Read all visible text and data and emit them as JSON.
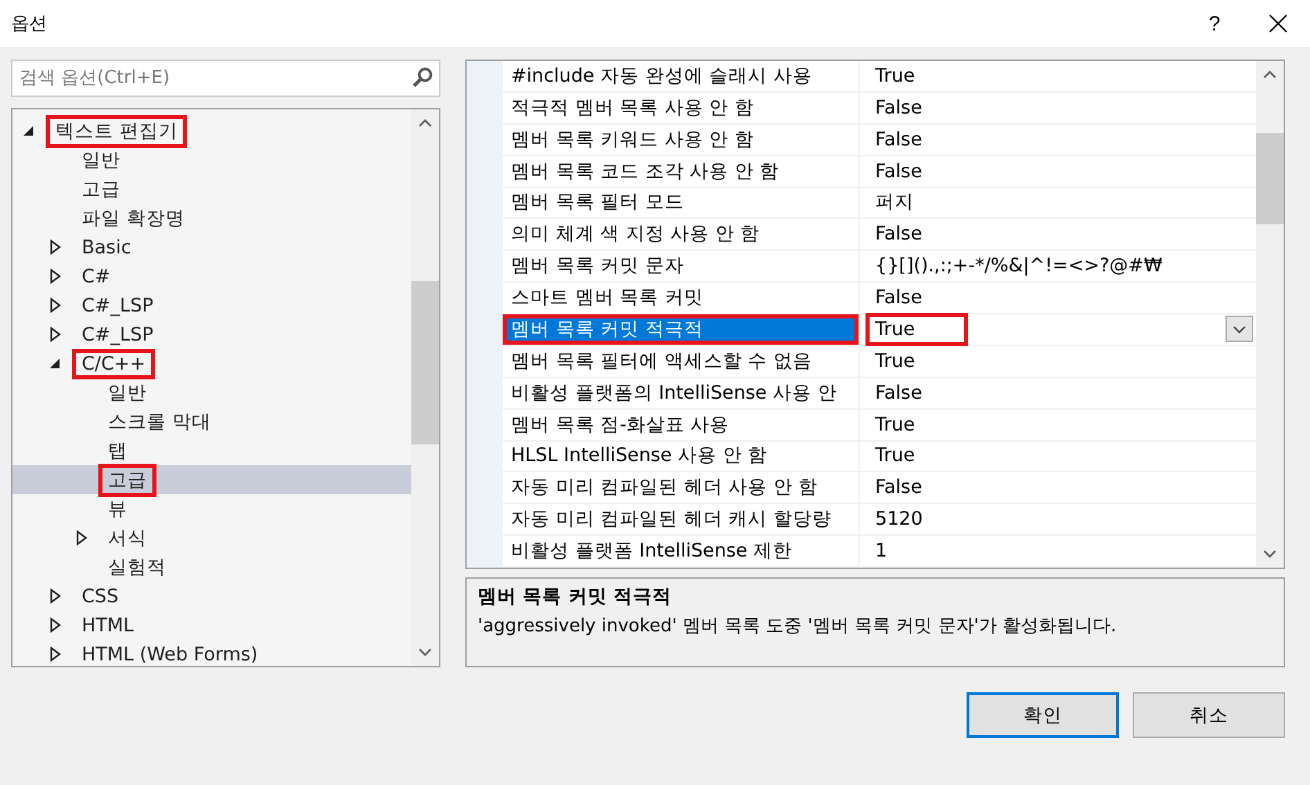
{
  "window": {
    "title": "옵션",
    "help": "?"
  },
  "search": {
    "placeholder": "검색 옵션(Ctrl+E)"
  },
  "tree": [
    {
      "label": "텍스트 편집기",
      "expanded": true,
      "selected": false,
      "highlighted": true,
      "children": [
        {
          "label": "일반",
          "selected": false,
          "highlighted": false
        },
        {
          "label": "고급",
          "selected": false,
          "highlighted": false
        },
        {
          "label": "파일 확장명",
          "selected": false,
          "highlighted": false
        },
        {
          "label": "Basic",
          "expanded": false,
          "selected": false,
          "highlighted": false
        },
        {
          "label": "C#",
          "expanded": false,
          "selected": false,
          "highlighted": false
        },
        {
          "label": "C#_LSP",
          "expanded": false,
          "selected": false,
          "highlighted": false
        },
        {
          "label": "C#_LSP",
          "expanded": false,
          "selected": false,
          "highlighted": false
        },
        {
          "label": "C/C++",
          "expanded": true,
          "selected": false,
          "highlighted": true,
          "children": [
            {
              "label": "일반",
              "selected": false,
              "highlighted": false
            },
            {
              "label": "스크롤 막대",
              "selected": false,
              "highlighted": false
            },
            {
              "label": "탭",
              "selected": false,
              "highlighted": false
            },
            {
              "label": "고급",
              "selected": true,
              "highlighted": true
            },
            {
              "label": "뷰",
              "selected": false,
              "highlighted": false
            },
            {
              "label": "서식",
              "expanded": false,
              "selected": false,
              "highlighted": false
            },
            {
              "label": "실험적",
              "selected": false,
              "highlighted": false
            }
          ]
        },
        {
          "label": "CSS",
          "expanded": false,
          "selected": false,
          "highlighted": false
        },
        {
          "label": "HTML",
          "expanded": false,
          "selected": false,
          "highlighted": false
        },
        {
          "label": "HTML (Web Forms)",
          "expanded": false,
          "selected": false,
          "highlighted": false
        }
      ]
    }
  ],
  "properties": [
    {
      "name": "#include 자동 완성에 슬래시 사용",
      "value": "True",
      "selected": false
    },
    {
      "name": "적극적 멤버 목록 사용 안 함",
      "value": "False",
      "selected": false
    },
    {
      "name": "멤버 목록 키워드 사용 안 함",
      "value": "False",
      "selected": false
    },
    {
      "name": "멤버 목록 코드 조각 사용 안 함",
      "value": "False",
      "selected": false
    },
    {
      "name": "멤버 목록 필터 모드",
      "value": "퍼지",
      "selected": false
    },
    {
      "name": "의미 체계 색 지정 사용 안 함",
      "value": "False",
      "selected": false
    },
    {
      "name": "멤버 목록 커밋 문자",
      "value": "{}[]().,:;+-*/%&|^!=<>?@#₩",
      "selected": false
    },
    {
      "name": "스마트 멤버 목록 커밋",
      "value": "False",
      "selected": false
    },
    {
      "name": "멤버 목록 커밋 적극적",
      "value": "True",
      "selected": true
    },
    {
      "name": "멤버 목록 필터에 액세스할 수 없음",
      "value": "True",
      "selected": false
    },
    {
      "name": "비활성 플랫폼의 IntelliSense 사용 안",
      "value": "False",
      "selected": false
    },
    {
      "name": "멤버 목록 점-화살표 사용",
      "value": "True",
      "selected": false
    },
    {
      "name": "HLSL IntelliSense 사용 안 함",
      "value": "True",
      "selected": false
    },
    {
      "name": "자동 미리 컴파일된 헤더 사용 안 함",
      "value": "False",
      "selected": false
    },
    {
      "name": "자동 미리 컴파일된 헤더 캐시 할당량",
      "value": "5120",
      "selected": false
    },
    {
      "name": "비활성 플랫폼 IntelliSense 제한",
      "value": "1",
      "selected": false
    }
  ],
  "description": {
    "title": "멤버 목록 커밋 적극적",
    "text": "'aggressively invoked' 멤버 목록 도중 '멤버 목록 커밋 문자'가 활성화됩니다."
  },
  "buttons": [
    {
      "label": "확인",
      "kind": "primary"
    },
    {
      "label": "취소",
      "kind": "normal"
    }
  ]
}
